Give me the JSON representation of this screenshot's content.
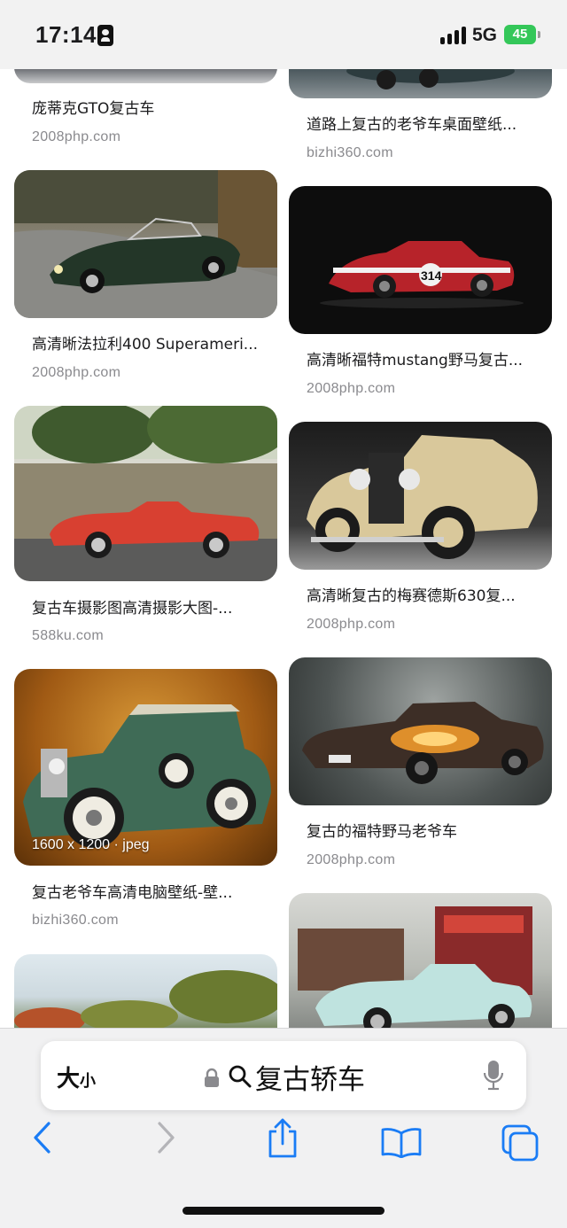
{
  "status_bar": {
    "time": "17:14",
    "network": "5G",
    "battery": "45",
    "icons": [
      "focus-icon",
      "signal-icon",
      "battery-icon"
    ]
  },
  "results": [
    {
      "title": "庞蒂克GTO复古车",
      "source": "2008php.com"
    },
    {
      "title": "道路上复古的老爷车桌面壁纸...",
      "source": "bizhi360.com"
    },
    {
      "title": "高清晰法拉利400 Superameri...",
      "source": "2008php.com"
    },
    {
      "title": "高清晰福特mustang野马复古...",
      "source": "2008php.com"
    },
    {
      "title": "复古车摄影图高清摄影大图-...",
      "source": "588ku.com"
    },
    {
      "title": "高清晰复古的梅赛德斯630复...",
      "source": "2008php.com"
    },
    {
      "title": "复古老爷车高清电脑壁纸-壁...",
      "source": "bizhi360.com",
      "image_meta": "1600 x 1200 · jpeg"
    },
    {
      "title": "复古的福特野马老爷车",
      "source": "2008php.com"
    }
  ],
  "address_bar": {
    "text_size_big": "大",
    "text_size_small": "小",
    "query": "复古轿车"
  },
  "toolbar": {
    "buttons": [
      "back-icon",
      "forward-icon",
      "share-icon",
      "bookmarks-icon",
      "tabs-icon"
    ],
    "accent": "#1a7cf5"
  }
}
